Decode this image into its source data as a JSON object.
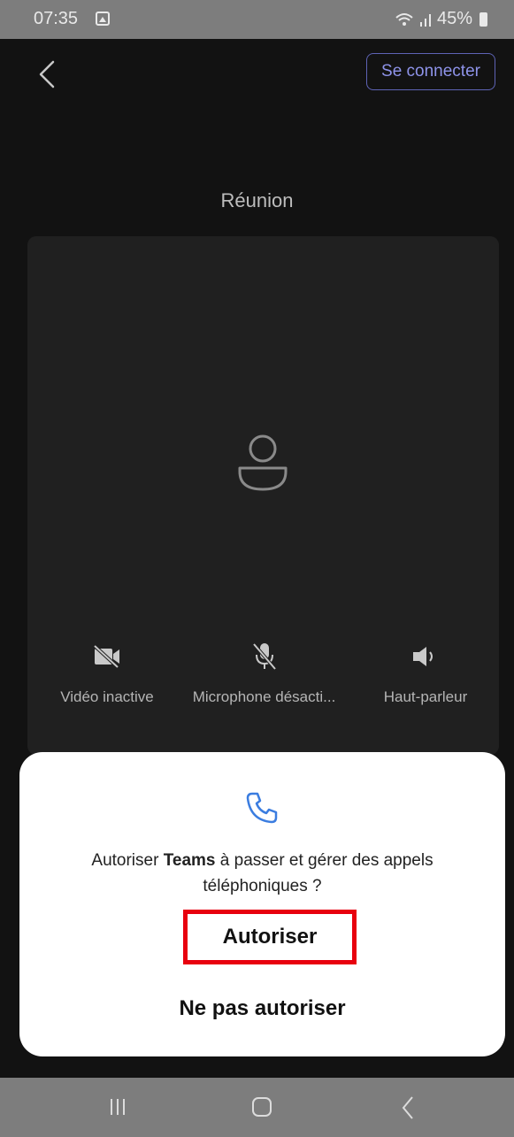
{
  "status_bar": {
    "time": "07:35",
    "battery": "45%"
  },
  "header": {
    "sign_in_label": "Se connecter"
  },
  "meeting": {
    "title": "Réunion",
    "controls": [
      {
        "icon": "video-off-icon",
        "label": "Vidéo inactive"
      },
      {
        "icon": "mic-off-icon",
        "label": "Microphone désacti..."
      },
      {
        "icon": "speaker-icon",
        "label": "Haut-parleur"
      }
    ]
  },
  "dialog": {
    "icon": "phone-icon",
    "message_prefix": "Autoriser ",
    "app_name": "Teams",
    "message_suffix": " à passer et gérer des appels téléphoniques ?",
    "allow_label": "Autoriser",
    "deny_label": "Ne pas autoriser",
    "highlight_color": "#e8000e",
    "icon_color": "#3b7de0"
  }
}
